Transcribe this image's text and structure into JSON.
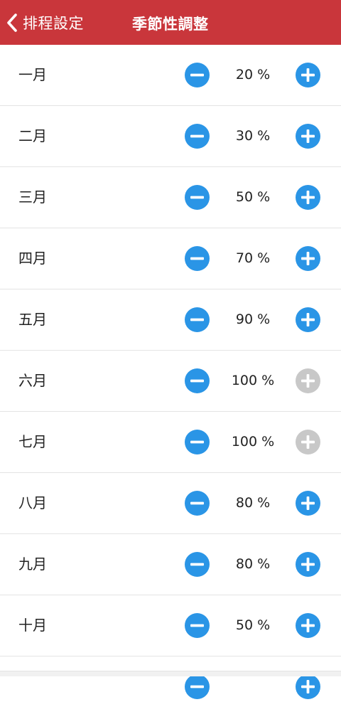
{
  "header": {
    "back_label": "排程設定",
    "title": "季節性調整"
  },
  "colors": {
    "header_bg": "#c9363b",
    "button_active": "#2a95e6",
    "button_disabled": "#c8c8c8"
  },
  "months": [
    {
      "label": "一月",
      "value": "20 %",
      "plus_enabled": true
    },
    {
      "label": "二月",
      "value": "30 %",
      "plus_enabled": true
    },
    {
      "label": "三月",
      "value": "50 %",
      "plus_enabled": true
    },
    {
      "label": "四月",
      "value": "70 %",
      "plus_enabled": true
    },
    {
      "label": "五月",
      "value": "90 %",
      "plus_enabled": true
    },
    {
      "label": "六月",
      "value": "100 %",
      "plus_enabled": false
    },
    {
      "label": "七月",
      "value": "100 %",
      "plus_enabled": false
    },
    {
      "label": "八月",
      "value": "80 %",
      "plus_enabled": true
    },
    {
      "label": "九月",
      "value": "80 %",
      "plus_enabled": true
    },
    {
      "label": "十月",
      "value": "50 %",
      "plus_enabled": true
    }
  ]
}
